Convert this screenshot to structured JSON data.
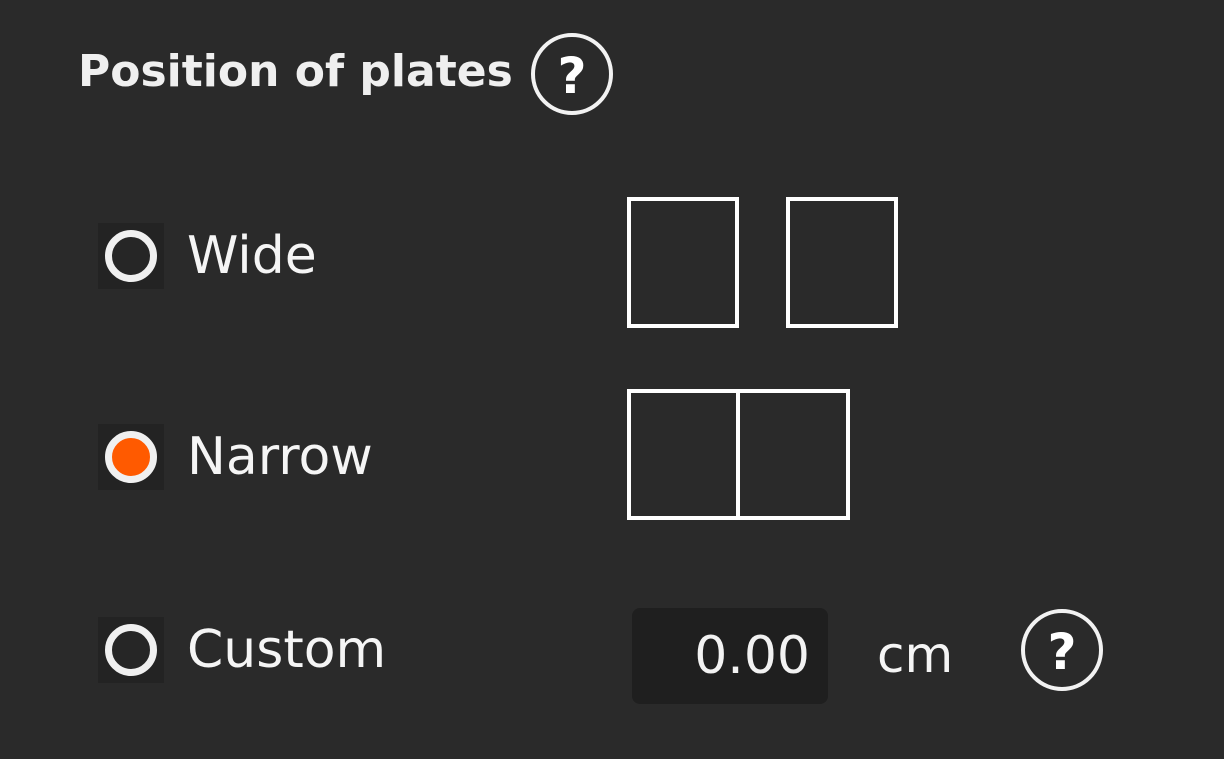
{
  "section": {
    "title": "Position of plates",
    "help_glyph": "?"
  },
  "options": [
    {
      "label": "Wide",
      "checked": false,
      "plate_layout": "wide"
    },
    {
      "label": "Narrow",
      "checked": true,
      "plate_layout": "narrow"
    },
    {
      "label": "Custom",
      "checked": false
    }
  ],
  "custom": {
    "value": "0.00",
    "unit": "cm",
    "help_glyph": "?"
  },
  "colors": {
    "background": "#2a2a2a",
    "accent": "#ff5a00",
    "text": "#f5f5f5",
    "input_background": "#1f1f1f"
  }
}
